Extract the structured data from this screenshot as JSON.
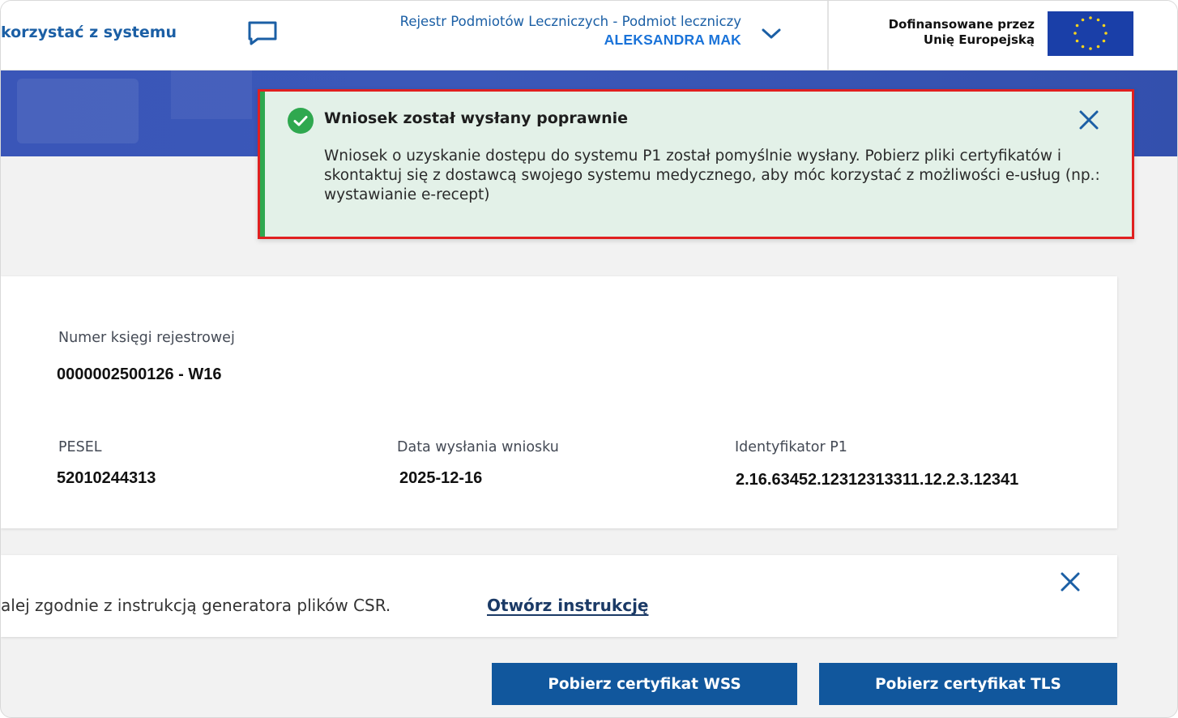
{
  "header": {
    "how_to_text": "korzystać z systemu",
    "registry_title": "Rejestr Podmiotów Leczniczych - Podmiot leczniczy",
    "user_name": "ALEKSANDRA MAK",
    "eu_text_line1": "Dofinansowane przez",
    "eu_text_line2": "Unię Europejską",
    "icons": {
      "chat": "chat-icon",
      "chevron": "chevron-down-icon",
      "eu_flag": "eu-flag-icon"
    }
  },
  "toast": {
    "title": "Wniosek został wysłany poprawnie",
    "body": "Wniosek o uzyskanie dostępu do systemu P1 został pomyślnie wysłany. Pobierz pliki certyfikatów i skontaktuj się z dostawcą swojego systemu medycznego, aby móc korzystać z możliwości e-usług (np.: wystawianie e-recept)",
    "icons": {
      "status": "check-circle-icon",
      "close": "close-icon"
    },
    "colors": {
      "background": "#e3f1e8",
      "accent": "#2fa84f",
      "highlight_border": "#e02020"
    }
  },
  "info": {
    "register_number_label": "Numer księgi rejestrowej",
    "register_number_value": "0000002500126 - W16",
    "pesel_label": "PESEL",
    "pesel_value": "52010244313",
    "date_label": "Data wysłania wniosku",
    "date_value": "2025-12-16",
    "p1_id_label": "Identyfikator P1",
    "p1_id_value": "2.16.63452.12312313311.12.2.3.12341"
  },
  "instruction": {
    "text": "alej zgodnie z instrukcją generatora plików CSR.",
    "link": "Otwórz instrukcję"
  },
  "buttons": {
    "wss": "Pobierz certyfikat WSS",
    "tls": "Pobierz certyfikat TLS"
  },
  "colors": {
    "brand_blue": "#1b5fa5",
    "button_blue": "#11579d",
    "banner_blue": "#3a56b8"
  }
}
